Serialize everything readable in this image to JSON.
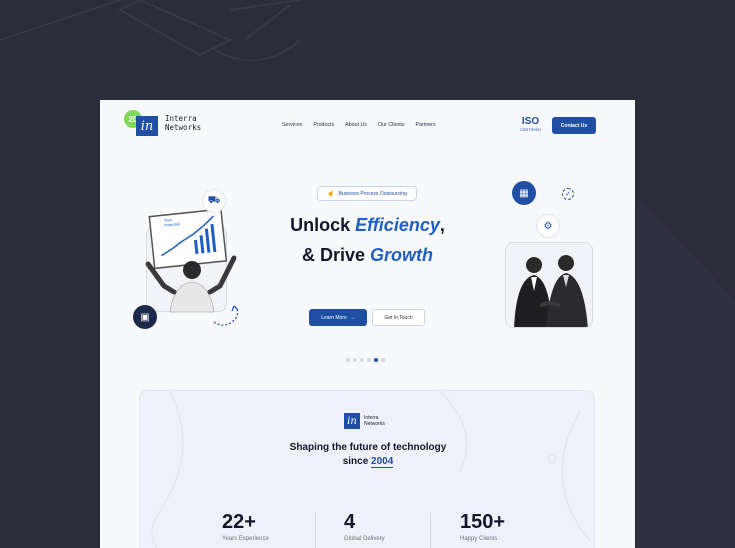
{
  "brand": {
    "badge": "20",
    "mark": "in",
    "name_line1": "Interra",
    "name_line2": "Networks"
  },
  "nav": {
    "items": [
      "Services",
      "Products",
      "About Us",
      "Our Clients",
      "Partners"
    ]
  },
  "iso": {
    "mark": "ISO",
    "sub": "CERTIFIED"
  },
  "header": {
    "contact_label": "Contact Us"
  },
  "hero": {
    "pill_label": "Business Process Outsourcing",
    "title_1": "Unlock ",
    "title_em1": "Efficiency",
    "title_2": ",",
    "title_3": "& Drive ",
    "title_em2": "Growth",
    "learn_label": "Learn More",
    "learn_arrow": "→",
    "touch_label": "Get In Touch",
    "slides": 6,
    "active_slide": 5,
    "sign_text_1": "Your",
    "sign_text_2": "Potential"
  },
  "stats": {
    "logo_mark": "in",
    "logo_line1": "Interra",
    "logo_line2": "Networks",
    "headline_1": "Shaping the future of technology",
    "headline_2": "since ",
    "headline_year": "2004",
    "items": [
      {
        "value": "22+",
        "label": "Years Experience"
      },
      {
        "value": "4",
        "label": "Global Delivery"
      },
      {
        "value": "150+",
        "label": "Happy Clients"
      }
    ]
  },
  "colors": {
    "primary": "#1e4fa3",
    "accent": "#1e5fc2",
    "badge": "#7ed957",
    "backdrop": "#2b2d3b"
  }
}
